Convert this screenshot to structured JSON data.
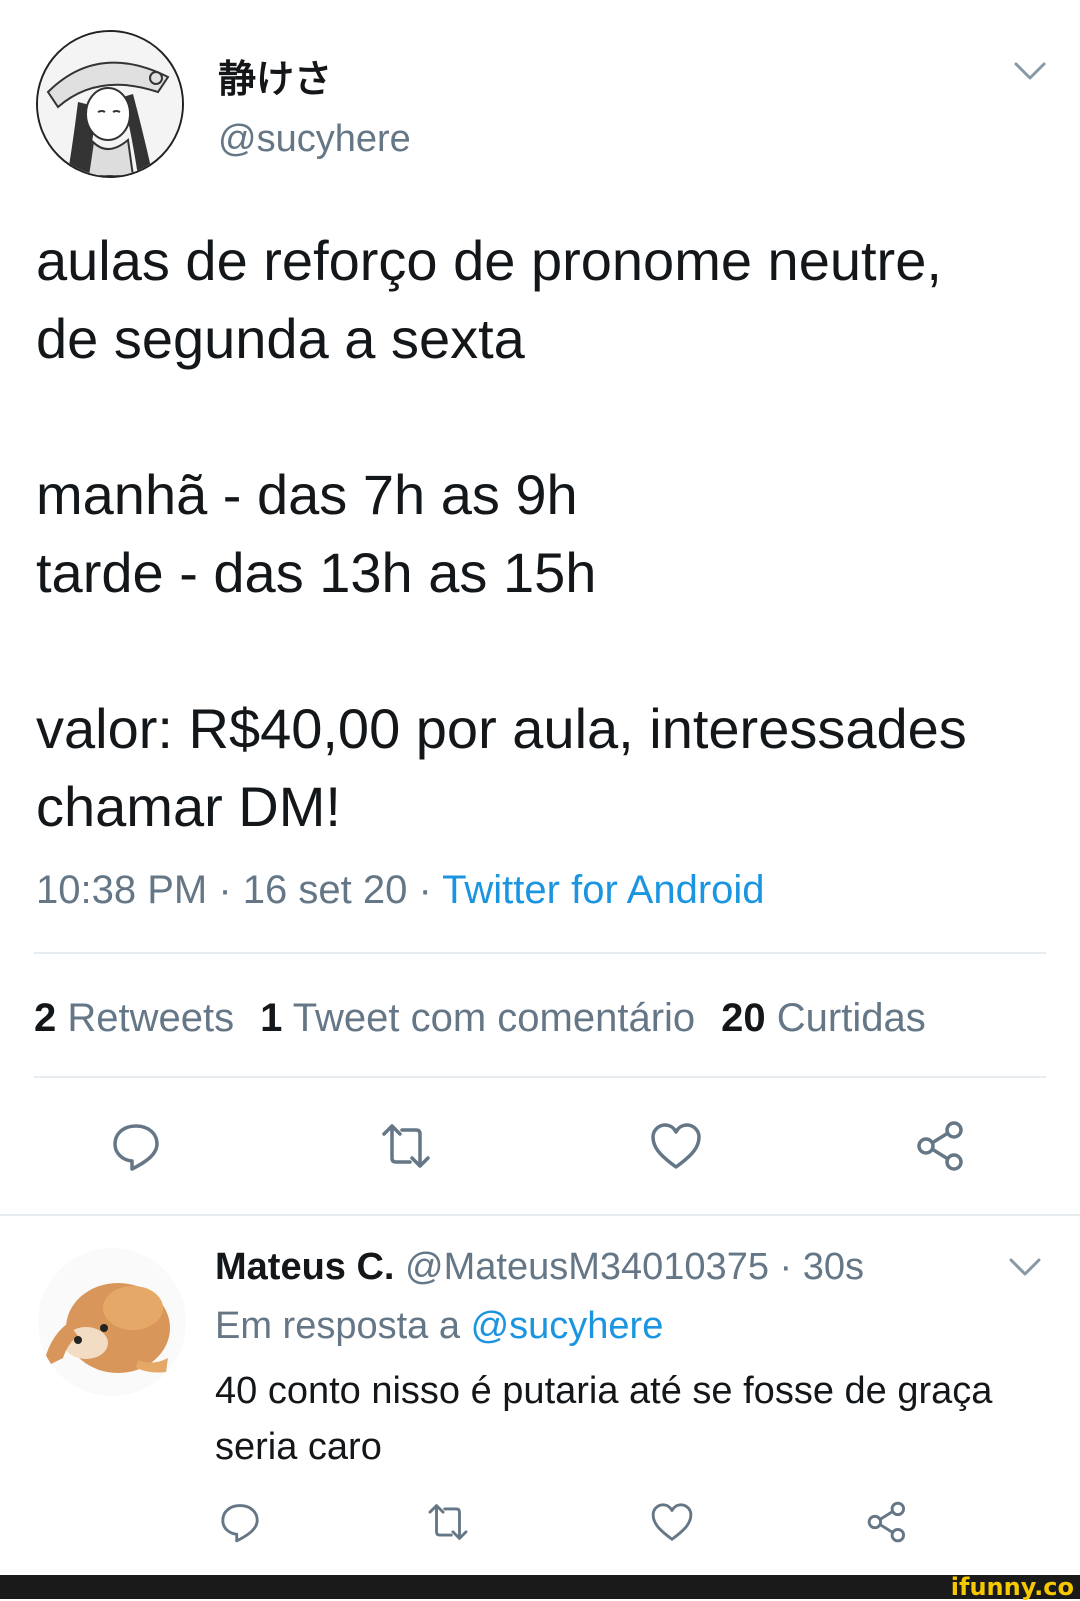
{
  "main_tweet": {
    "display_name": "静けさ",
    "handle": "@sucyhere",
    "text": "aulas de reforço de pronome neutre,\nde segunda a sexta\n\nmanhã - das 7h as 9h\ntarde - das 13h as 15h\n\nvalor: R$40,00 por aula, interessades\nchamar DM!",
    "time": "10:38 PM",
    "date": "16 set 20",
    "source": "Twitter for Android",
    "separator": " · ",
    "stats": {
      "retweets_count": "2",
      "retweets_label": "Retweets",
      "quotes_count": "1",
      "quotes_label": "Tweet com comentário",
      "likes_count": "20",
      "likes_label": "Curtidas"
    }
  },
  "reply": {
    "display_name": "Mateus C.",
    "handle": "@MateusM34010375",
    "time": "30s",
    "in_reply_prefix": "Em resposta a",
    "in_reply_mention": "@sucyhere",
    "text": "40 conto nisso é putaria até se fosse de graça seria caro"
  },
  "watermark": "ifunny.co",
  "icons": [
    "reply-icon",
    "retweet-icon",
    "like-icon",
    "share-icon",
    "chevron-down-icon"
  ],
  "colors": {
    "link": "#1b95e0",
    "secondary": "#657786",
    "primary": "#14171a",
    "divider": "#e6ecf0"
  }
}
